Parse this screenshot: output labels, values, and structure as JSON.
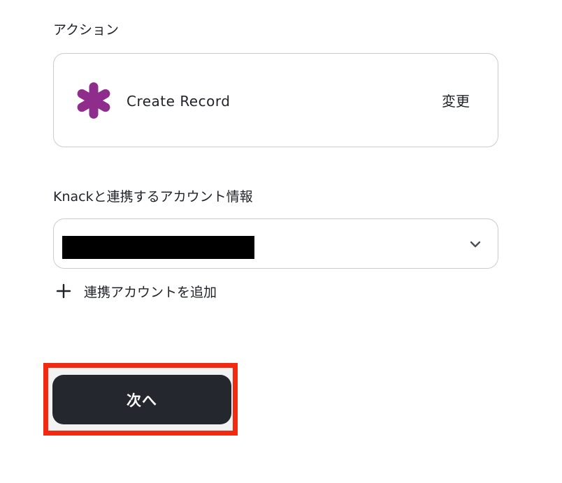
{
  "action_section": {
    "label": "アクション",
    "action_name": "Create Record",
    "change_label": "変更",
    "app_icon": "knack-asterisk-icon",
    "app_icon_color": "#8e2d8c"
  },
  "account_section": {
    "label": "Knackと連携するアカウント情報",
    "selected_value_redacted": true,
    "add_account_label": "連携アカウントを追加"
  },
  "footer": {
    "next_label": "次へ",
    "button_color": "#24272d",
    "highlight_color": "#f42a10"
  }
}
